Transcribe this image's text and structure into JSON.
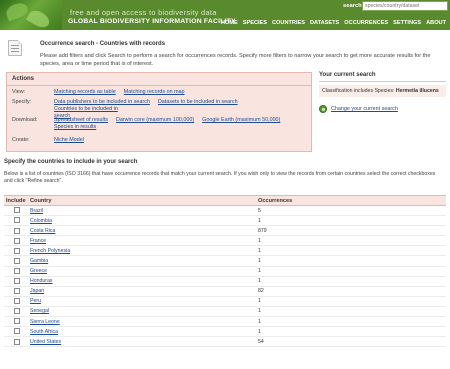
{
  "header": {
    "tagline": "free and open access to biodiversity data",
    "facility": "GLOBAL BIODIVERSITY INFORMATION FACILITY",
    "search_label": "search",
    "search_placeholder": "species/country/dataset",
    "nav": [
      "HOME",
      "SPECIES",
      "COUNTRIES",
      "DATASETS",
      "OCCURRENCES",
      "SETTINGS",
      "ABOUT"
    ]
  },
  "page": {
    "title": "Occurrence search - Countries with records",
    "description": "Please add filters and click Search to perform a search for occurrences records. Specify more filters to narrow your search to get more accurate results for the species, area or time period that is of interest."
  },
  "actions": {
    "heading": "Actions",
    "view_label": "View:",
    "view_links": [
      "Matching records as table",
      "Matching records on map"
    ],
    "specify_label": "Specify:",
    "specify_links": [
      "Data publishers to be included in search",
      "Datasets to be included in search",
      "Countries to be included in search"
    ],
    "download_label": "Download:",
    "download_links": [
      "Spreadsheet of results",
      "Darwin core (maximum 100,000)",
      "Google Earth (maximum 50,000)",
      "Species in results"
    ],
    "create_label": "Create:",
    "create_links": [
      "Niche Model"
    ]
  },
  "current_search": {
    "heading": "Your current search",
    "classification_label": "Classification includes Species:",
    "classification_value": "Hermetia illucens",
    "change_link": "Change your current search"
  },
  "specify_section": {
    "title": "Specify the countries to include in your search",
    "description": "Below is a list of countries (ISO 3166) that have occurrence records that match your current search. If you wish only to view the records from certain countries select the correct checkboxes and click \"Refine search\"."
  },
  "table": {
    "headers": [
      "Include",
      "Country",
      "Occurrences"
    ],
    "rows": [
      {
        "country": "Brazil",
        "occurrences": "5"
      },
      {
        "country": "Colombia",
        "occurrences": "1"
      },
      {
        "country": "Costa Rica",
        "occurrences": "879"
      },
      {
        "country": "France",
        "occurrences": "1"
      },
      {
        "country": "French Polynesia",
        "occurrences": "1"
      },
      {
        "country": "Gambia",
        "occurrences": "1"
      },
      {
        "country": "Greece",
        "occurrences": "1"
      },
      {
        "country": "Honduras",
        "occurrences": "1"
      },
      {
        "country": "Japan",
        "occurrences": "82"
      },
      {
        "country": "Peru",
        "occurrences": "1"
      },
      {
        "country": "Senegal",
        "occurrences": "1"
      },
      {
        "country": "Sierra Leone",
        "occurrences": "1"
      },
      {
        "country": "South Africa",
        "occurrences": "1"
      },
      {
        "country": "United States",
        "occurrences": "54"
      }
    ]
  }
}
